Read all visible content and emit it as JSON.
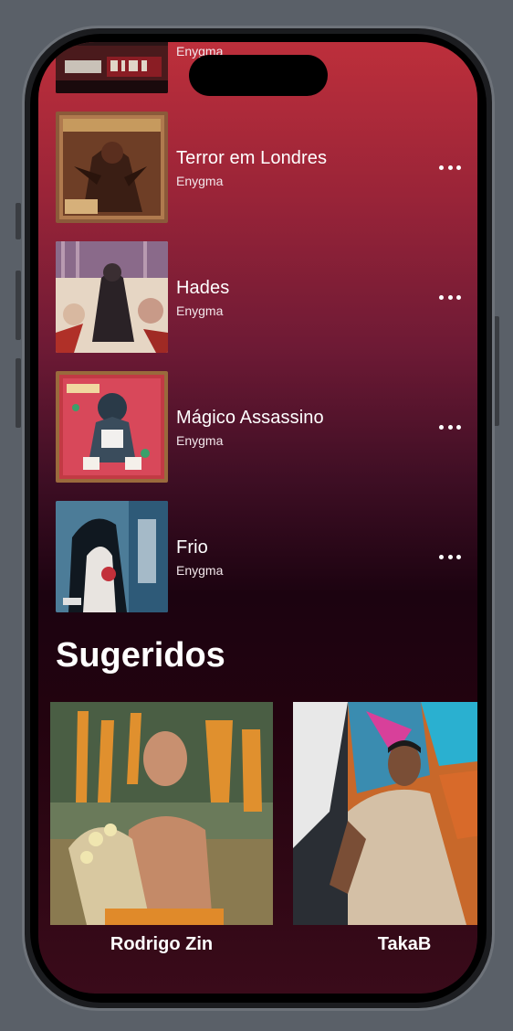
{
  "songs": [
    {
      "title": "",
      "artist": "Enygma"
    },
    {
      "title": "Terror em Londres",
      "artist": "Enygma"
    },
    {
      "title": "Hades",
      "artist": "Enygma"
    },
    {
      "title": "Mágico Assassino",
      "artist": "Enygma"
    },
    {
      "title": "Frio",
      "artist": "Enygma"
    }
  ],
  "suggested": {
    "title": "Sugeridos",
    "artists": [
      {
        "name": "Rodrigo Zin"
      },
      {
        "name": "TakaB"
      }
    ]
  },
  "colors": {
    "gradient_top": "#bd2f3b",
    "gradient_mid": "#3e0e24",
    "gradient_bottom": "#23030f"
  },
  "icons": {
    "more": "ellipsis-horizontal-icon"
  }
}
